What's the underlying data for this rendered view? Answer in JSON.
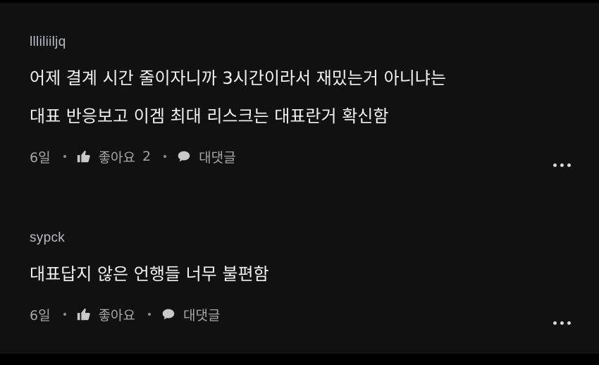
{
  "comments": [
    {
      "username": "llliliiljq",
      "lines": [
        "어제 결계 시간 줄이자니까 3시간이라서 재밌는거 아니냐는",
        "대표 반응보고 이겜 최대 리스크는 대표란거 확신함"
      ],
      "age": "6일",
      "like_label": "좋아요",
      "like_count": "2",
      "reply_label": "대댓글"
    },
    {
      "username": "sypck",
      "lines": [
        "대표답지 않은 언행들 너무 불편함"
      ],
      "age": "6일",
      "like_label": "좋아요",
      "like_count": "",
      "reply_label": "대댓글"
    }
  ],
  "icons": {
    "like": "thumbs-up-icon",
    "reply": "speech-bubble-icon",
    "more": "more-horizontal-icon"
  }
}
